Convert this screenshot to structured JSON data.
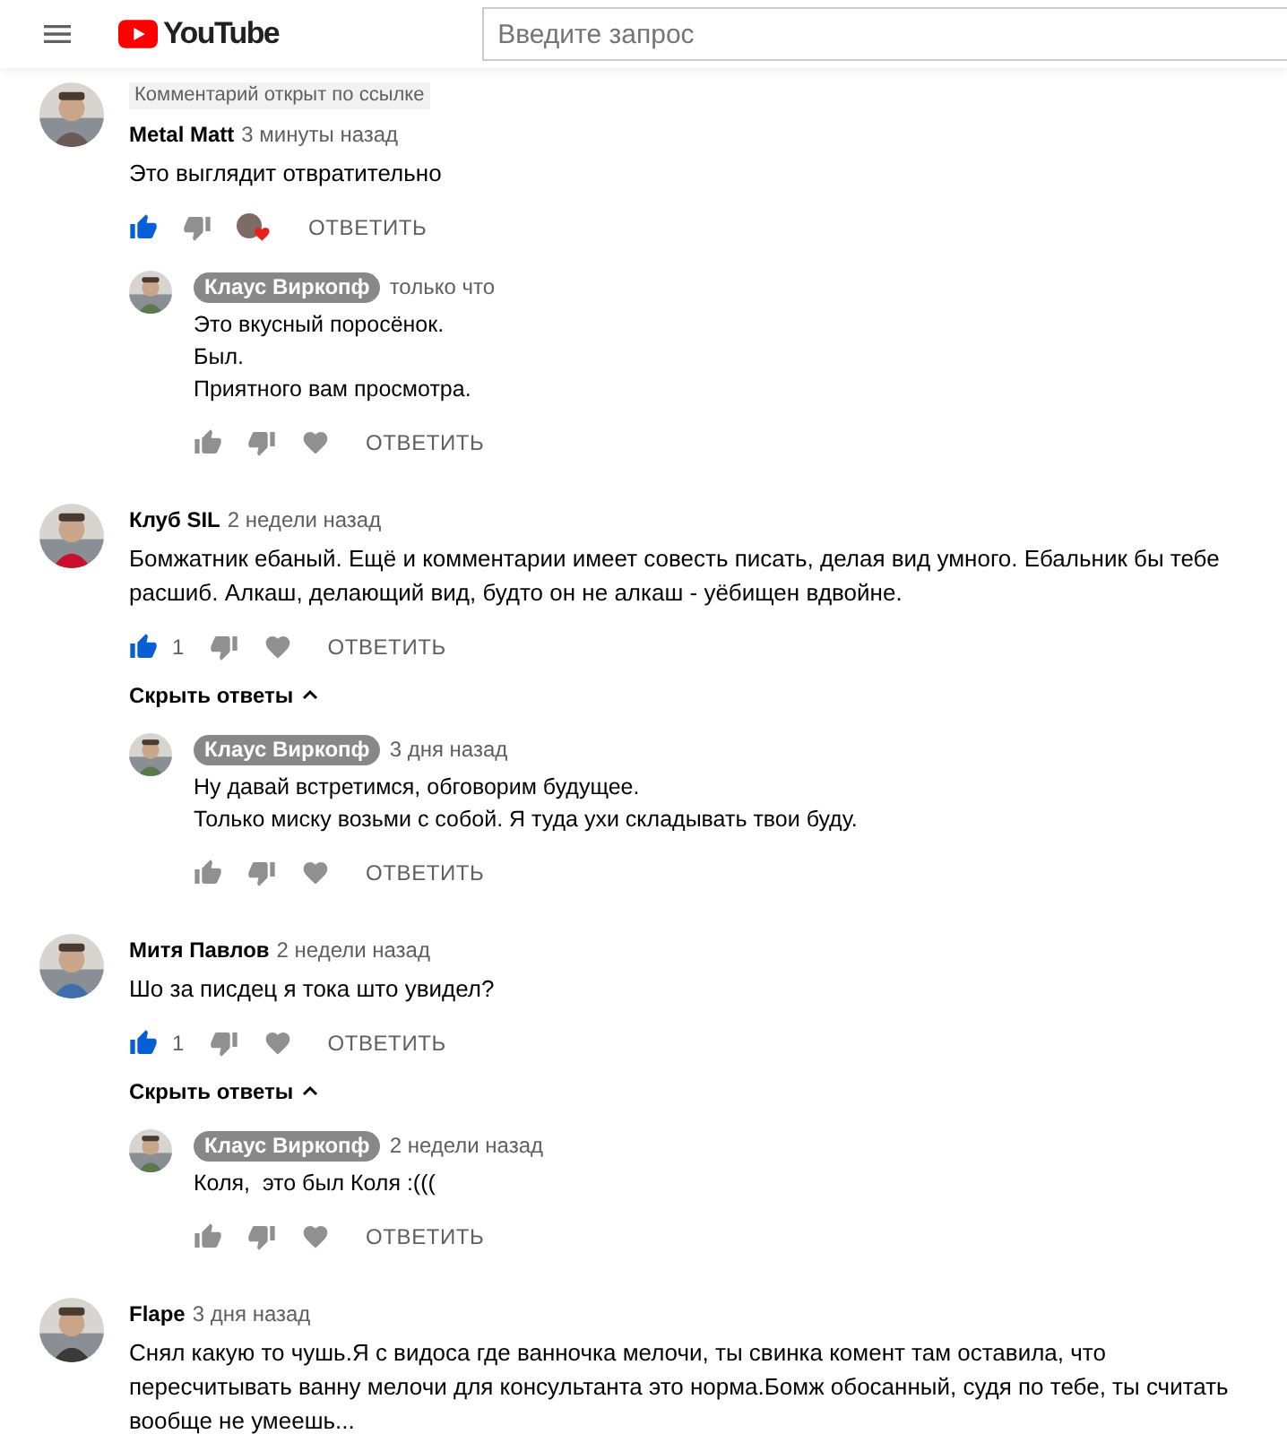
{
  "header": {
    "logo": "YouTube",
    "search": {
      "placeholder": "Введите запрос"
    }
  },
  "comments": [
    {
      "label": "Комментарий открыт по ссылке",
      "author": "Metal Matt",
      "time": "3 минуты назад",
      "lines": [
        "Это выглядит отвратительно"
      ],
      "liked": true,
      "disliked": false,
      "creator_heart": true,
      "reply": "ОТВЕТИТЬ",
      "replies": [
        {
          "author": "Клаус Виркопф",
          "creator": true,
          "time": "только что",
          "lines": [
            "Это вкусный поросёнок.",
            "Был.",
            "Приятного вам просмотра."
          ],
          "liked": false,
          "disliked": false,
          "reply": "ОТВЕТИТЬ"
        }
      ]
    },
    {
      "author": "Клуб SIL",
      "time": "2 недели назад",
      "lines": [
        "Бомжатник ебаный. Ещё и комментарии имеет совесть писать, делая вид умного. Ебальник бы тебе расшиб. Алкаш, делающий вид, будто он не алкаш - уёбищен вдвойне."
      ],
      "liked": true,
      "disliked": false,
      "like_count": "1",
      "creator_heart": false,
      "reply": "ОТВЕТИТЬ",
      "toggle": "Скрыть ответы",
      "replies": [
        {
          "author": "Клаус Виркопф",
          "creator": true,
          "time": "3 дня назад",
          "lines": [
            "Ну давай встретимся, обговорим будущее.",
            "Только миску возьми с собой. Я туда ухи складывать твои буду."
          ],
          "liked": false,
          "disliked": false,
          "reply": "ОТВЕТИТЬ"
        }
      ]
    },
    {
      "author": "Митя Павлов",
      "time": "2 недели назад",
      "lines": [
        "Шо за писдец я тока што увидел?"
      ],
      "liked": true,
      "disliked": false,
      "like_count": "1",
      "creator_heart": false,
      "reply": "ОТВЕТИТЬ",
      "toggle": "Скрыть ответы",
      "replies": [
        {
          "author": "Клаус Виркопф",
          "creator": true,
          "time": "2 недели назад",
          "lines": [
            "Коля,  это был Коля :((("
          ],
          "liked": false,
          "disliked": false,
          "reply": "ОТВЕТИТЬ"
        }
      ]
    },
    {
      "author": "Flape",
      "time": "3 дня назад",
      "lines": [
        "Снял какую то чушь.Я с видоса где ванночка мелочи, ты свинка комент там оставила, что пересчитывать ванну мелочи для консультанта это норма.Бомж обосанный, судя по тебе, ты считать вообще не умеешь..."
      ]
    }
  ]
}
